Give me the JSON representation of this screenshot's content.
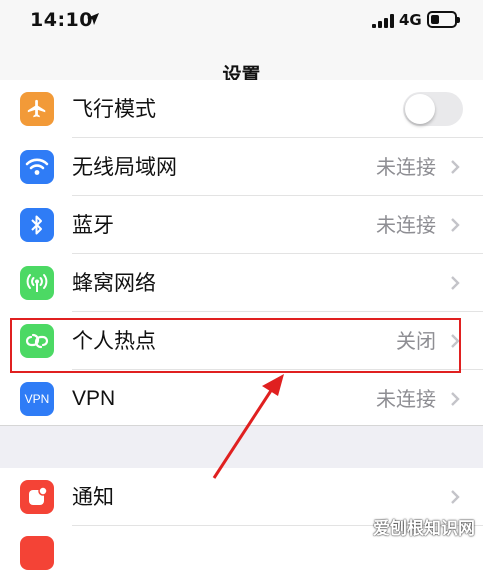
{
  "status_bar": {
    "time": "14:10",
    "network": "4G",
    "battery_level": 0.35
  },
  "navbar": {
    "title": "设置"
  },
  "settings_group_1": [
    {
      "id": "airplane",
      "label": "飞行模式",
      "icon": "airplane-icon",
      "icon_color": "#f29a38",
      "control": "toggle",
      "toggle_on": false
    },
    {
      "id": "wifi",
      "label": "无线局域网",
      "icon": "wifi-icon",
      "icon_color": "#2f7cf6",
      "value": "未连接"
    },
    {
      "id": "bluetooth",
      "label": "蓝牙",
      "icon": "bluetooth-icon",
      "icon_color": "#2f7cf6",
      "value": "未连接"
    },
    {
      "id": "cellular",
      "label": "蜂窝网络",
      "icon": "cellular-icon",
      "icon_color": "#4cd964"
    },
    {
      "id": "hotspot",
      "label": "个人热点",
      "icon": "hotspot-icon",
      "icon_color": "#4cd964",
      "value": "关闭"
    },
    {
      "id": "vpn",
      "label": "VPN",
      "icon": "vpn-icon",
      "icon_color": "#2f7cf6",
      "icon_text": "VPN",
      "value": "未连接"
    }
  ],
  "settings_group_2": [
    {
      "id": "notifications",
      "label": "通知",
      "icon": "notifications-icon",
      "icon_color": "#f44336"
    }
  ],
  "annotation": {
    "highlight_color": "#e02020",
    "highlighted_item": "个人热点"
  },
  "watermark": "爱刨根知识网"
}
